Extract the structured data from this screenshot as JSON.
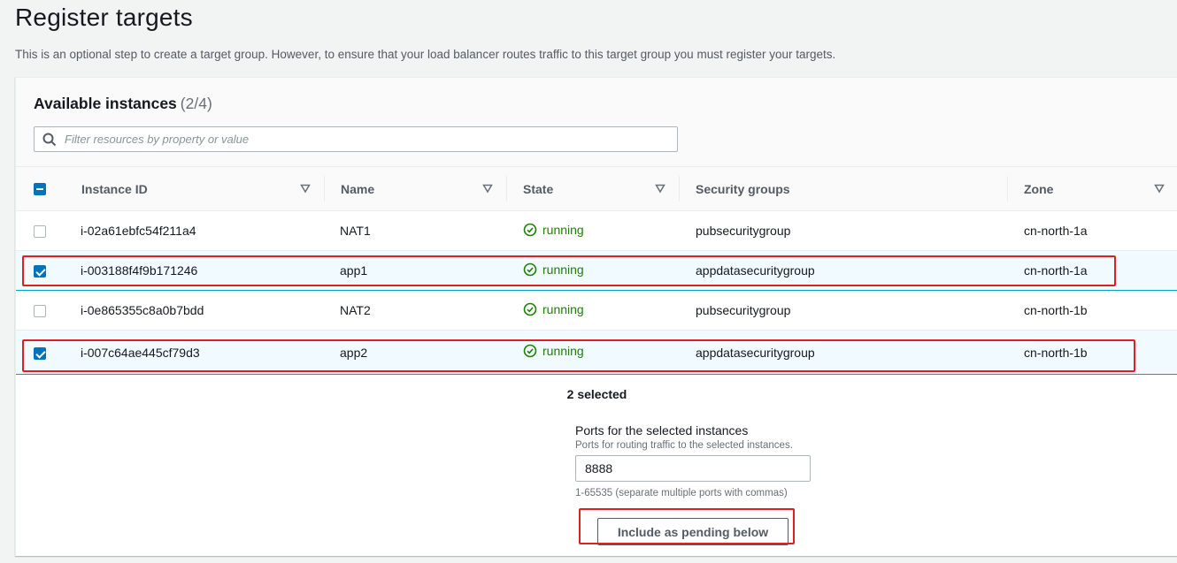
{
  "page": {
    "title": "Register targets",
    "description": "This is an optional step to create a target group. However, to ensure that your load balancer routes traffic to this target group you must register your targets."
  },
  "instances_panel": {
    "title": "Available instances",
    "count": "(2/4)",
    "filter_placeholder": "Filter resources by property or value",
    "columns": [
      "Instance ID",
      "Name",
      "State",
      "Security groups",
      "Zone"
    ],
    "rows": [
      {
        "instance_id": "i-02a61ebfc54f211a4",
        "name": "NAT1",
        "state": "running",
        "security_groups": "pubsecuritygroup",
        "zone": "cn-north-1a",
        "selected": false
      },
      {
        "instance_id": "i-003188f4f9b171246",
        "name": "app1",
        "state": "running",
        "security_groups": "appdatasecuritygroup",
        "zone": "cn-north-1a",
        "selected": true
      },
      {
        "instance_id": "i-0e865355c8a0b7bdd",
        "name": "NAT2",
        "state": "running",
        "security_groups": "pubsecuritygroup",
        "zone": "cn-north-1b",
        "selected": false
      },
      {
        "instance_id": "i-007c64ae445cf79d3",
        "name": "app2",
        "state": "running",
        "security_groups": "appdatasecuritygroup",
        "zone": "cn-north-1b",
        "selected": true
      }
    ],
    "selected_summary": "2 selected"
  },
  "ports": {
    "label": "Ports for the selected instances",
    "description": "Ports for routing traffic to the selected instances.",
    "value": "8888",
    "hint": "1-65535 (separate multiple ports with commas)"
  },
  "actions": {
    "include_label": "Include as pending below"
  },
  "colors": {
    "running_green": "#1d8102",
    "checkbox_blue": "#0073bb",
    "highlight_red": "#e02020"
  }
}
